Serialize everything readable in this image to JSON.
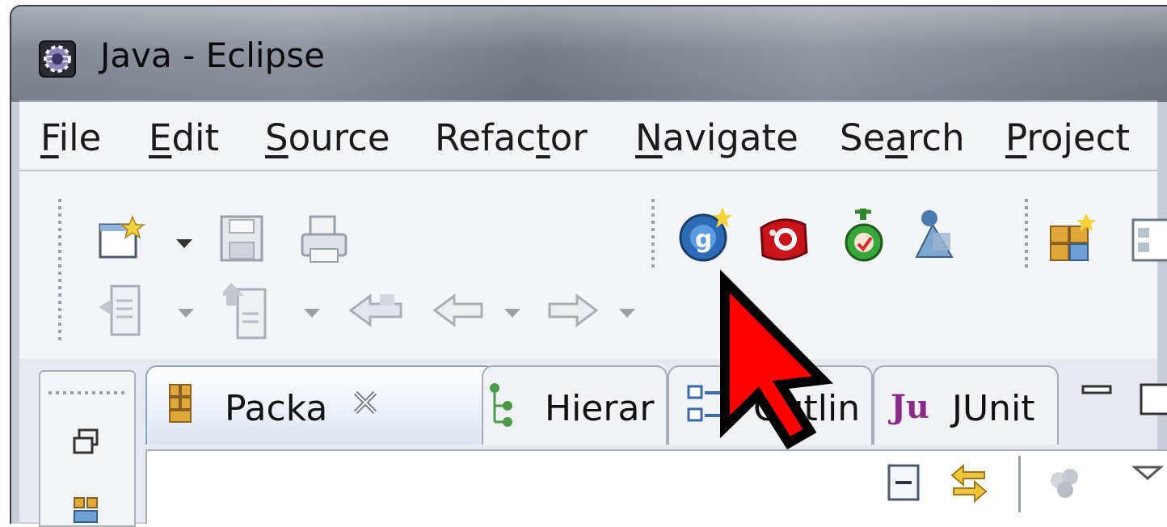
{
  "window": {
    "title": "Java - Eclipse",
    "app_icon": "eclipse-icon"
  },
  "menubar": {
    "items": [
      {
        "label": "File",
        "underline": "F"
      },
      {
        "label": "Edit",
        "underline": "E"
      },
      {
        "label": "Source",
        "underline": "S"
      },
      {
        "label": "Refactor",
        "underline": "t"
      },
      {
        "label": "Navigate",
        "underline": "N"
      },
      {
        "label": "Search",
        "underline": "a"
      },
      {
        "label": "Project",
        "underline": "P"
      }
    ]
  },
  "toolbar": {
    "row1": [
      "new-wizard-icon",
      "save-icon",
      "print-icon",
      "new-google-project-icon",
      "deploy-icon",
      "debug-run-icon",
      "publish-icon",
      "new-java-package-icon",
      "new-class-icon"
    ],
    "row2": [
      "next-annotation-icon",
      "previous-annotation-icon",
      "last-edit-location-icon",
      "back-icon",
      "forward-icon"
    ]
  },
  "views": {
    "tabs": [
      {
        "label": "Packa",
        "icon": "package-explorer-icon",
        "active": true
      },
      {
        "label": "Hierar",
        "icon": "hierarchy-icon",
        "active": false
      },
      {
        "label": "Outlin",
        "icon": "outline-icon",
        "active": false
      },
      {
        "label": "JUnit",
        "icon": "junit-icon",
        "prefix": "Ju",
        "active": false
      }
    ]
  },
  "colors": {
    "cursor": "#ff0000",
    "menubar_bg": "#f2f4f7",
    "toolbar_bg": "#f4f5f8"
  }
}
